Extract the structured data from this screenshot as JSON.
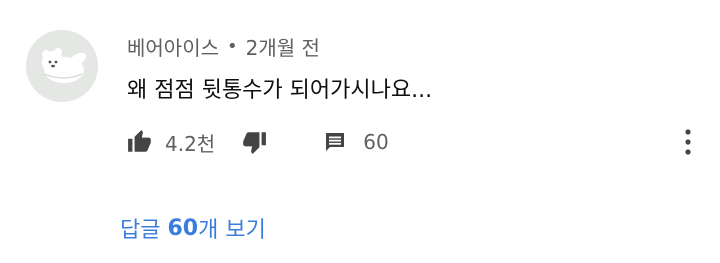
{
  "comment": {
    "author": "베어아이스",
    "separator": "•",
    "time": "2개월 전",
    "text": "왜 점점 뒷통수가 되어가시나요...",
    "like_count": "4.2천",
    "reply_count": "60"
  },
  "replies": {
    "label_prefix": "답글",
    "count": "60",
    "label_suffix": "개 보기"
  },
  "icons": {
    "like": "thumbs-up-icon",
    "dislike": "thumbs-down-icon",
    "reply": "comment-icon",
    "more": "more-vertical-icon"
  },
  "colors": {
    "icon": "#444444",
    "secondary_text": "#606060",
    "link": "#3b7ddd",
    "avatar_bg": "#e4e7e4"
  }
}
